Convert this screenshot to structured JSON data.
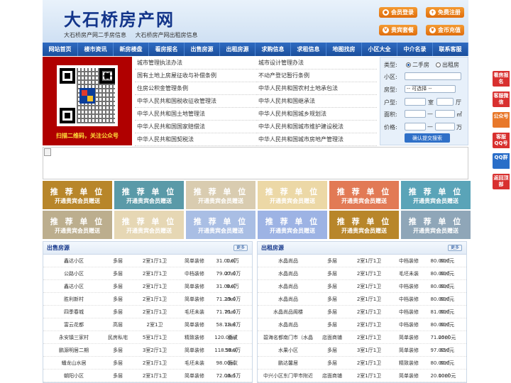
{
  "header": {
    "title": "大石桥房产网",
    "subtitle_1": "大石桥房产网二手房信息",
    "subtitle_2": "大石桥房产网出租房信息",
    "buttons": {
      "login": "会员登录",
      "register": "免费注册",
      "package": "贵宾套餐",
      "recharge": "金币充值"
    }
  },
  "nav": [
    "网站首页",
    "楼市资讯",
    "新房楼盘",
    "看房报名",
    "出售房源",
    "出租房源",
    "求购信息",
    "求租信息",
    "地图找房",
    "小区大全",
    "中介名录",
    "联系客服"
  ],
  "qr": {
    "caption": "扫描二维码，关注公众号"
  },
  "laws_left": [
    "城市管理执法办法",
    "国有土地上房屋征收与补偿条例",
    "住房公积金管理条例",
    "中华人民共和国税收征收管理法",
    "中华人民共和国土地管理法",
    "中华人民共和国国家赔偿法",
    "中华人民共和国契税法"
  ],
  "laws_right": [
    "城市设计管理办法",
    "不动产登记暂行条例",
    "中华人民共和国农村土地承包法",
    "中华人民共和国继承法",
    "中华人民共和国城乡规划法",
    "中华人民共和国城市维护建设税法",
    "中华人民共和国城市房地产管理法"
  ],
  "search": {
    "type_label": "类型:",
    "type_options": [
      "二手房",
      "出租房"
    ],
    "community_label": "小区:",
    "house_label": "房型:",
    "house_select": "-- 可选择 --",
    "layout_label": "户型:",
    "room_unit": "室",
    "hall_unit": "厅",
    "area_label": "面积:",
    "area_sep": "—",
    "area_unit": "㎡",
    "price_label": "价格:",
    "price_sep": "—",
    "price_unit": "万",
    "submit": "确认提交搜索"
  },
  "ads": {
    "title": "推 荐 单 位",
    "subtitle": "开通贵宾会员赠送",
    "colors": [
      "#b8862a",
      "#5a9aa8",
      "#d9ccb0",
      "#ecd8a6",
      "#e27a55",
      "#5aa4b8",
      "#bcae8e",
      "#e6d7b4",
      "#a9bee4",
      "#9db3e4",
      "#b8862a",
      "#8fa6b8"
    ]
  },
  "sale": {
    "title": "出售房源",
    "more": "更多",
    "rows": [
      [
        "鑫达小区",
        "多层",
        "2室1厅1卫",
        "简单装修",
        "31.00㎡",
        "1.0万"
      ],
      [
        "公路小区",
        "多层",
        "2室1厅1卫",
        "中档装修",
        "79.00㎡",
        "27.0万"
      ],
      [
        "鑫达小区",
        "多层",
        "2室1厅1卫",
        "简单装修",
        "31.00㎡",
        "9.0万"
      ],
      [
        "胜利新村",
        "多层",
        "2室1厅1卫",
        "简单装修",
        "71.20㎡",
        "19.0万"
      ],
      [
        "四季春城",
        "多层",
        "2室1厅1卫",
        "毛坯未装",
        "71.76㎡",
        "21.0万"
      ],
      [
        "富云花都",
        "高层",
        "2室1卫",
        "简单装修",
        "58.71㎡",
        "18.8万"
      ],
      [
        "永安镇三家村",
        "民房私宅",
        "5室1厅1卫",
        "精致装修",
        "120.00㎡",
        "面议"
      ],
      [
        "鹏源明居二期",
        "多层",
        "3室2厅1卫",
        "简单装修",
        "118.50㎡",
        "59.0万"
      ],
      [
        "蟠龙山水居",
        "多层",
        "2室1厅1卫",
        "毛坯未装",
        "98.00㎡",
        "面议"
      ],
      [
        "朝阳小区",
        "多层",
        "2室1厅1卫",
        "简单装修",
        "72.00㎡",
        "16.5万"
      ]
    ]
  },
  "rent": {
    "title": "出租房源",
    "more": "更多",
    "rows": [
      [
        "水晶尚品",
        "多层",
        "2室1厅1卫",
        "中档装修",
        "80.00㎡",
        "600元"
      ],
      [
        "水晶尚品",
        "多层",
        "2室1厅1卫",
        "毛坯未装",
        "80.00㎡",
        "600元"
      ],
      [
        "水晶尚品",
        "多层",
        "2室1厅1卫",
        "中档装修",
        "80.00㎡",
        "600元"
      ],
      [
        "水晶尚品",
        "多层",
        "2室1厅1卫",
        "中档装修",
        "80.00㎡",
        "600元"
      ],
      [
        "水晶尚品阁楼",
        "多层",
        "2室1厅1卫",
        "中档装修",
        "81.00㎡",
        "600元"
      ],
      [
        "水晶尚品",
        "多层",
        "2室1厅1卫",
        "中档装修",
        "80.00㎡",
        "600元"
      ],
      [
        "碧海名都南门市（水晶",
        "店面商铺",
        "2室1厅1卫",
        "简单装修",
        "71.00㎡",
        "2500元"
      ],
      [
        "水果小区",
        "多层",
        "3室1厅1卫",
        "简单装修",
        "97.00㎡",
        "650元"
      ],
      [
        "鹏达馨居",
        "多层",
        "2室1厅1卫",
        "精致装修",
        "80.00㎡",
        "600元"
      ],
      [
        "中兴小区东门甲市附近",
        "店面商铺",
        "2室1厅1卫",
        "简单装修",
        "20.00㎡",
        "1000元"
      ]
    ]
  },
  "side": [
    "看房报名",
    "客服微信",
    "公众号",
    "客服QQ号",
    "QQ群",
    "返回顶部"
  ]
}
